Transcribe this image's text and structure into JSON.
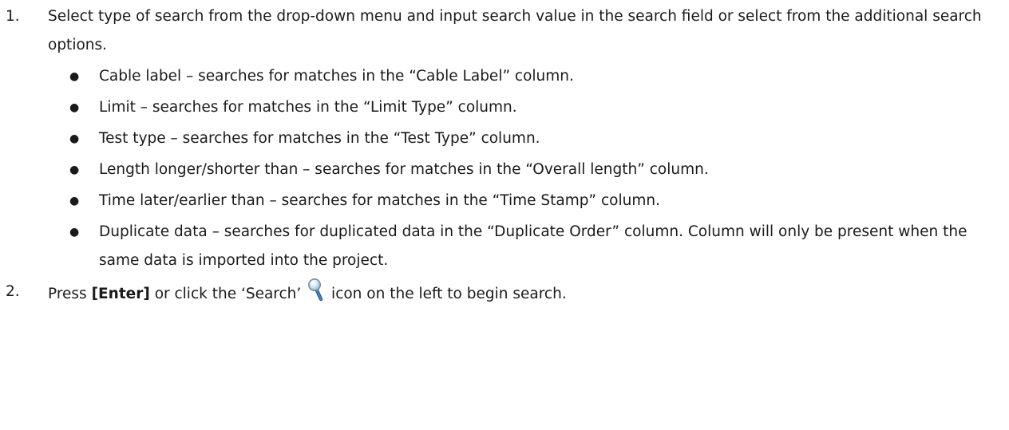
{
  "steps": [
    {
      "number": "1.",
      "text": "Select type of search from the drop-down menu and input search value in the search field or select from the additional search options."
    },
    {
      "number": "2.",
      "text_before_key": "Press ",
      "key": "[Enter]",
      "text_mid": " or click the ‘Search’",
      "text_after_icon": " icon on the left to begin search."
    }
  ],
  "bullets": [
    {
      "text": "Cable label – searches for matches in the “Cable Label” column."
    },
    {
      "text": "Limit – searches for matches in the “Limit Type” column."
    },
    {
      "text": "Test type – searches for matches in the “Test Type” column."
    },
    {
      "text": "Length longer/shorter than – searches for matches in the “Overall length” column."
    },
    {
      "text": "Time later/earlier than – searches for matches in the “Time Stamp” column."
    },
    {
      "text": "Duplicate data – searches for duplicated data in the “Duplicate Order” column. Column will only be present when the same data is imported into the project."
    }
  ],
  "icons": {
    "search": "magnifier-icon"
  }
}
